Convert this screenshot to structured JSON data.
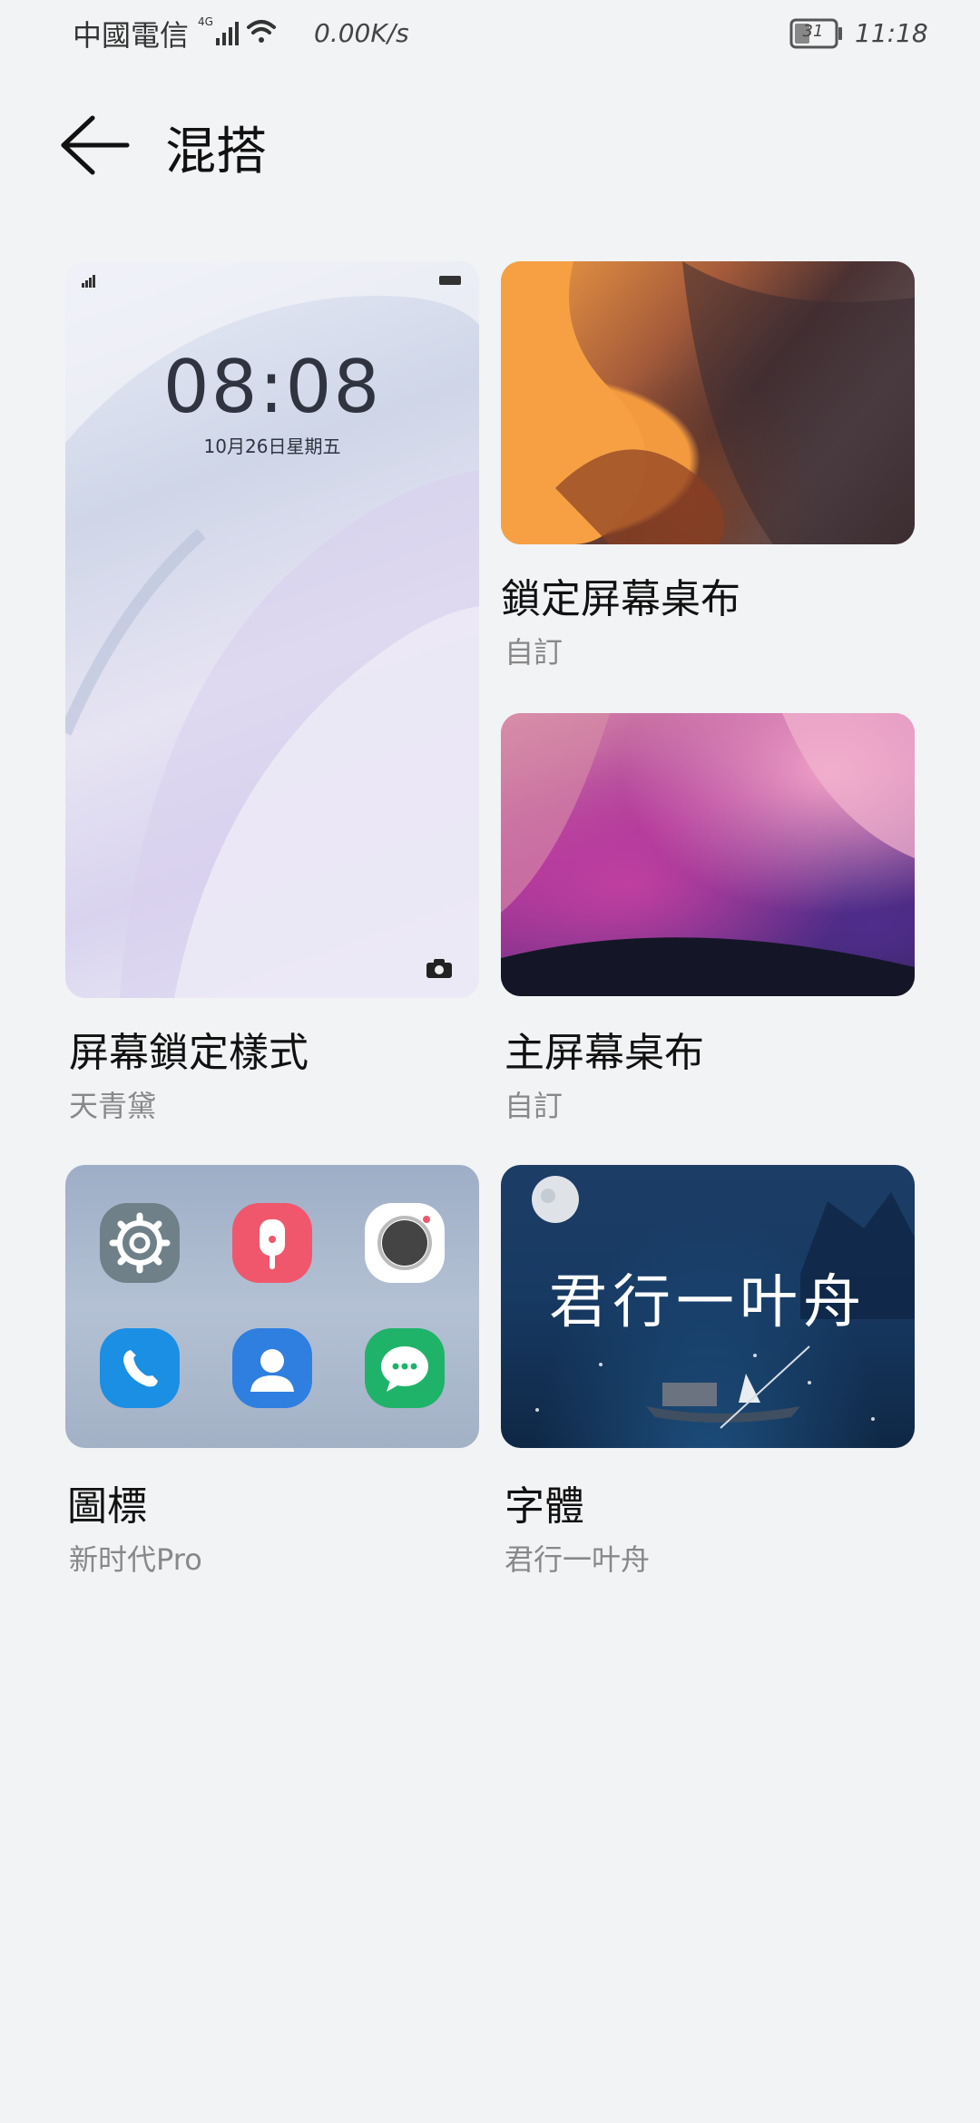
{
  "status_bar": {
    "carrier": "中國電信",
    "network": "4G",
    "speed": "0.00K/s",
    "battery": "31",
    "time": "11:18"
  },
  "header": {
    "title": "混搭"
  },
  "cards": {
    "lock_style": {
      "title": "屏幕鎖定樣式",
      "subtitle": "天青黛",
      "preview_time": "08:08",
      "preview_date": "10月26日星期五"
    },
    "lock_wallpaper": {
      "title": "鎖定屏幕桌布",
      "subtitle": "自訂"
    },
    "home_wallpaper": {
      "title": "主屏幕桌布",
      "subtitle": "自訂"
    },
    "icons": {
      "title": "圖標",
      "subtitle": "新时代Pro"
    },
    "font": {
      "title": "字體",
      "subtitle": "君行一叶舟",
      "preview_text": "君行一叶舟"
    }
  },
  "icon_names": [
    "settings-icon",
    "recorder-icon",
    "camera-icon",
    "phone-icon",
    "contacts-icon",
    "messages-icon"
  ],
  "colors": {
    "background": "#f1f3f5",
    "settings": "#6f8088",
    "recorder": "#f0576c",
    "camera": "#ffffff",
    "phone": "#1b8fe3",
    "contacts": "#2f7fe0",
    "messages": "#1fb36a"
  }
}
